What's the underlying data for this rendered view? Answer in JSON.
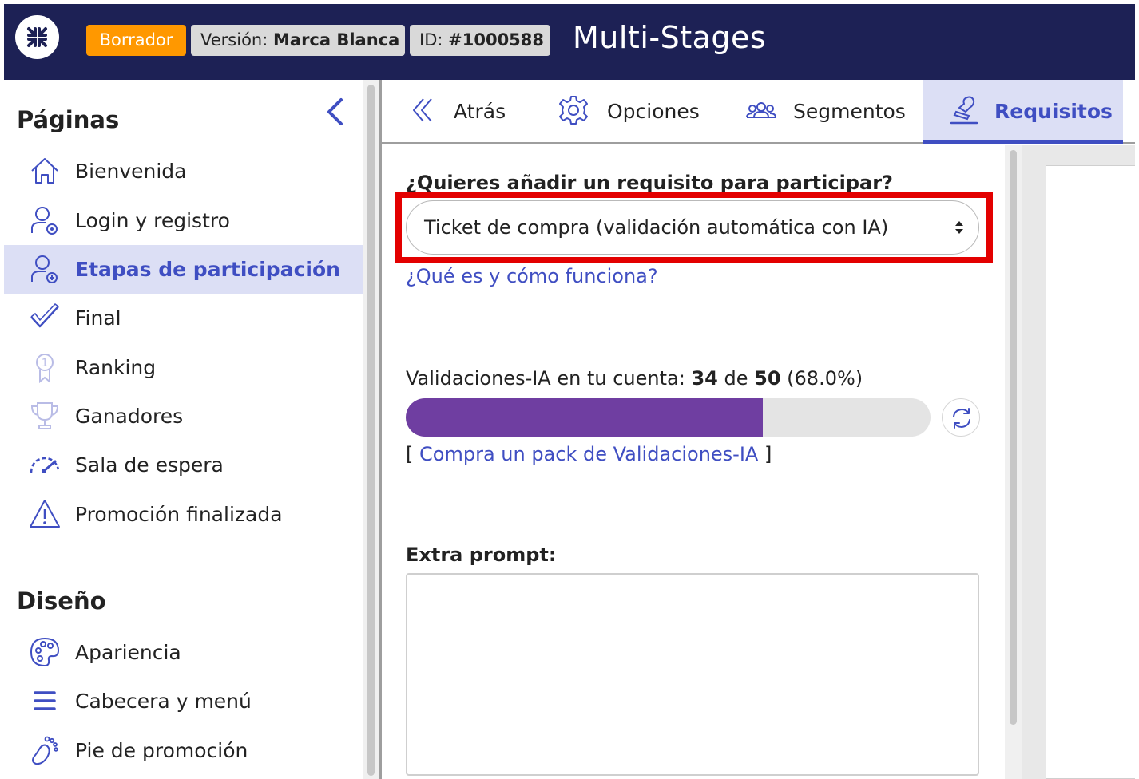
{
  "header": {
    "logo_icon": "brand-logo-icon",
    "status_badge": "Borrador",
    "version_label": "Versión:",
    "version_value": "Marca Blanca",
    "id_label": "ID:",
    "id_value": "#1000588",
    "title": "Multi-Stages",
    "colors": {
      "bar": "#1d2155",
      "draft_badge": "#ff9800",
      "gray_badge": "#d9d9d9"
    }
  },
  "sidebar": {
    "pages_title": "Páginas",
    "collapse_icon": "chevron-left-icon",
    "items": [
      {
        "label": "Bienvenida",
        "icon": "home-icon",
        "active": false
      },
      {
        "label": "Login y registro",
        "icon": "user-at-icon",
        "active": false
      },
      {
        "label": "Etapas de participación",
        "icon": "user-plus-icon",
        "active": true
      },
      {
        "label": "Final",
        "icon": "check-icon",
        "active": false
      },
      {
        "label": "Ranking",
        "icon": "medal-icon",
        "active": false
      },
      {
        "label": "Ganadores",
        "icon": "trophy-icon",
        "active": false
      },
      {
        "label": "Sala de espera",
        "icon": "gauge-icon",
        "active": false
      },
      {
        "label": "Promoción finalizada",
        "icon": "warning-icon",
        "active": false
      }
    ],
    "design_title": "Diseño",
    "design_items": [
      {
        "label": "Apariencia",
        "icon": "palette-icon"
      },
      {
        "label": "Cabecera y menú",
        "icon": "menu-icon"
      },
      {
        "label": "Pie de promoción",
        "icon": "footprint-icon"
      }
    ]
  },
  "tabs": [
    {
      "label": "Atrás",
      "icon": "double-chevron-left-icon",
      "active": false
    },
    {
      "label": "Opciones",
      "icon": "gear-icon",
      "active": false
    },
    {
      "label": "Segmentos",
      "icon": "users-group-icon",
      "active": false
    },
    {
      "label": "Requisitos",
      "icon": "stamp-icon",
      "active": true
    }
  ],
  "requirement": {
    "question": "¿Quieres añadir un requisito para participar?",
    "selected": "Ticket de compra (validación automática con IA)",
    "help_link": "¿Qué es y cómo funciona?"
  },
  "quota": {
    "label": "Validaciones-IA en tu cuenta:",
    "used": "34",
    "connector": "de",
    "total": "50",
    "percent_text": "(68.0%)",
    "fraction": 0.68,
    "bar_color": "#6f3ea1",
    "refresh_icon": "refresh-icon",
    "buy_open": "[",
    "buy_link": "Compra un pack de Validaciones-IA",
    "buy_close": "]"
  },
  "extra_prompt": {
    "label": "Extra prompt:",
    "value": ""
  }
}
